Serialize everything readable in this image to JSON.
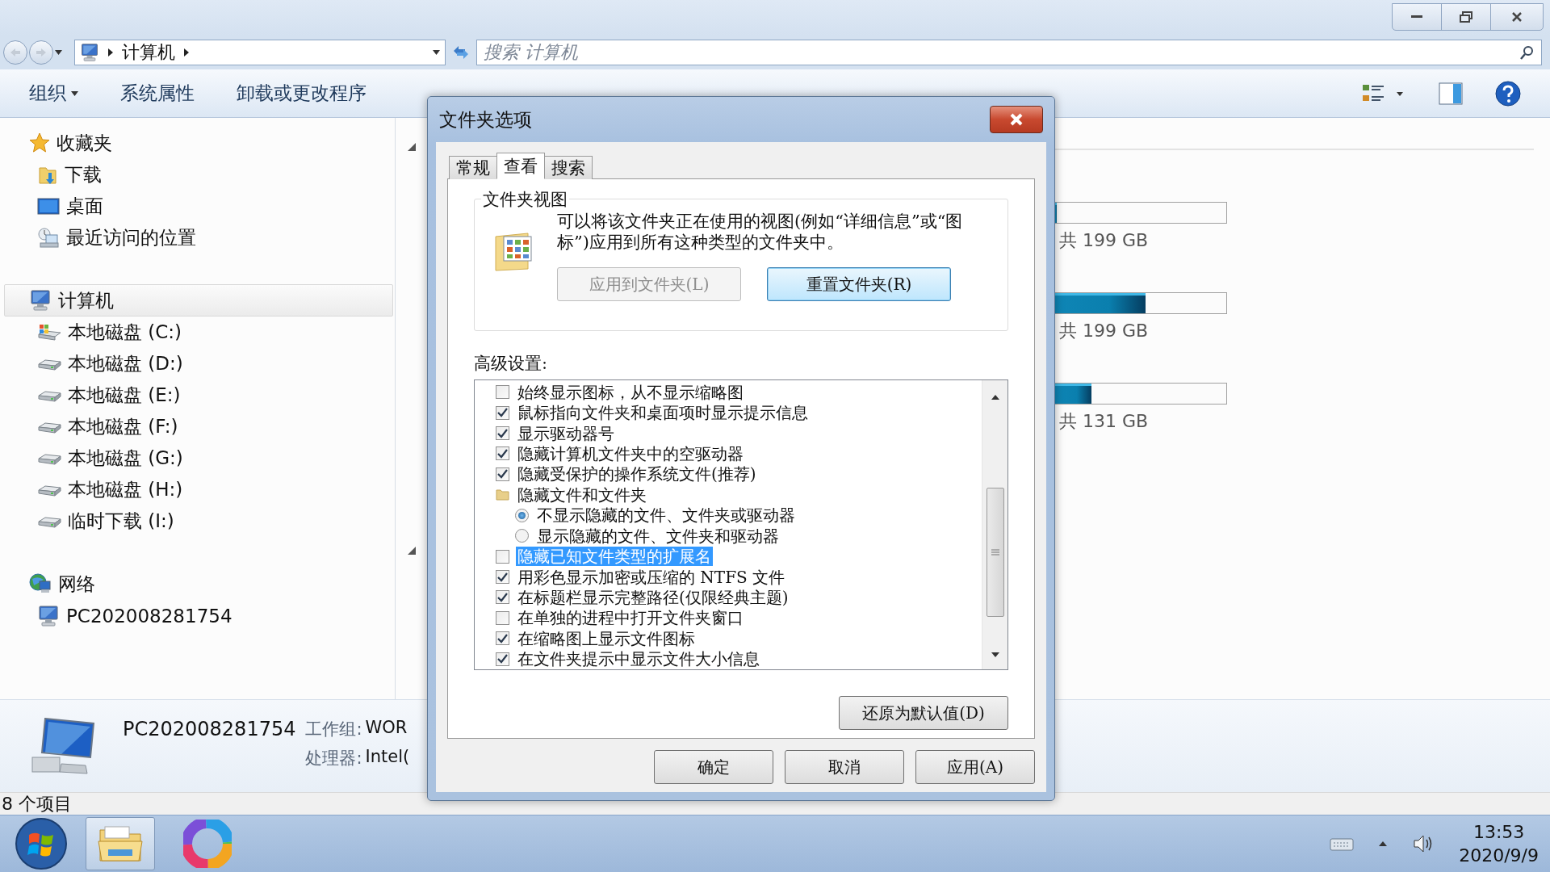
{
  "address_bar": {
    "path": [
      "计算机"
    ]
  },
  "search": {
    "placeholder": "搜索 计算机"
  },
  "toolbar": {
    "items": [
      {
        "label": "组织",
        "kind": "menu"
      },
      {
        "label": "系统属性",
        "kind": "plain"
      },
      {
        "label": "卸载或更改程序",
        "kind": "plain"
      }
    ]
  },
  "nav": {
    "sections": [
      {
        "label": "收藏夹",
        "kind": "favorites",
        "selected": false,
        "children": [
          {
            "label": "下载",
            "kind": "download",
            "selected": false
          },
          {
            "label": "桌面",
            "kind": "desktop",
            "selected": false
          },
          {
            "label": "最近访问的位置",
            "kind": "recent",
            "selected": false
          }
        ]
      },
      {
        "label": "计算机",
        "kind": "computer",
        "selected": true,
        "children": [
          {
            "label": "本地磁盘 (C:)",
            "kind": "system-drive",
            "selected": false
          },
          {
            "label": "本地磁盘 (D:)",
            "kind": "drive",
            "selected": false
          },
          {
            "label": "本地磁盘 (E:)",
            "kind": "drive",
            "selected": false
          },
          {
            "label": "本地磁盘 (F:)",
            "kind": "drive",
            "selected": false
          },
          {
            "label": "本地磁盘 (G:)",
            "kind": "drive",
            "selected": false
          },
          {
            "label": "本地磁盘 (H:)",
            "kind": "drive",
            "selected": false
          },
          {
            "label": "临时下载 (I:)",
            "kind": "drive",
            "selected": false
          }
        ]
      },
      {
        "label": "网络",
        "kind": "network",
        "selected": false,
        "children": [
          {
            "label": "PC202008281754",
            "kind": "pc",
            "selected": false
          }
        ]
      }
    ]
  },
  "drives": [
    {
      "level": 0,
      "size": "共 199 GB"
    },
    {
      "level": 0.53,
      "size": "共 199 GB"
    },
    {
      "level": 0.21,
      "size": "共 131 GB"
    }
  ],
  "details": {
    "name": "PC202008281754",
    "fields": [
      {
        "label": "工作组:",
        "value": "WOR"
      },
      {
        "label": "处理器:",
        "value": "Intel("
      }
    ]
  },
  "status_bar": "8 个项目",
  "dialog": {
    "title": "文件夹选项",
    "tabs": [
      {
        "label": "常规",
        "selected": false
      },
      {
        "label": "查看",
        "selected": true
      },
      {
        "label": "搜索",
        "selected": false
      }
    ],
    "folder_views": {
      "title": "文件夹视图",
      "description": "可以将该文件夹正在使用的视图(例如“详细信息”或“图标”)应用到所有这种类型的文件夹中。",
      "buttons": [
        {
          "label": "应用到文件夹(L)",
          "disabled": true,
          "focused": false
        },
        {
          "label": "重置文件夹(R)",
          "disabled": false,
          "focused": true
        }
      ]
    },
    "advanced_label": "高级设置:",
    "settings": [
      {
        "kind": "checkbox",
        "label": "始终显示图标，从不显示缩略图",
        "checked": false,
        "selected": false
      },
      {
        "kind": "checkbox",
        "label": "鼠标指向文件夹和桌面项时显示提示信息",
        "checked": true,
        "selected": false
      },
      {
        "kind": "checkbox",
        "label": "显示驱动器号",
        "checked": true,
        "selected": false
      },
      {
        "kind": "checkbox",
        "label": "隐藏计算机文件夹中的空驱动器",
        "checked": true,
        "selected": false
      },
      {
        "kind": "checkbox",
        "label": "隐藏受保护的操作系统文件(推荐)",
        "checked": true,
        "selected": false
      },
      {
        "kind": "folder",
        "label": "隐藏文件和文件夹",
        "selected": false
      },
      {
        "kind": "radio",
        "label": "不显示隐藏的文件、文件夹或驱动器",
        "checked": true,
        "selected": false
      },
      {
        "kind": "radio",
        "label": "显示隐藏的文件、文件夹和驱动器",
        "checked": false,
        "selected": false
      },
      {
        "kind": "checkbox",
        "label": "隐藏已知文件类型的扩展名",
        "checked": false,
        "selected": true
      },
      {
        "kind": "checkbox",
        "label": "用彩色显示加密或压缩的 NTFS 文件",
        "checked": true,
        "selected": false
      },
      {
        "kind": "checkbox",
        "label": "在标题栏显示完整路径(仅限经典主题)",
        "checked": true,
        "selected": false
      },
      {
        "kind": "checkbox",
        "label": "在单独的进程中打开文件夹窗口",
        "checked": false,
        "selected": false
      },
      {
        "kind": "checkbox",
        "label": "在缩略图上显示文件图标",
        "checked": true,
        "selected": false
      },
      {
        "kind": "checkbox",
        "label": "在文件夹提示中显示文件大小信息",
        "checked": true,
        "selected": false
      }
    ],
    "restore_button": "还原为默认值(D)",
    "buttons": [
      "确定",
      "取消",
      "应用(A)"
    ]
  },
  "taskbar": {
    "apps": [
      {
        "kind": "explorer",
        "selected": true
      },
      {
        "kind": "browser",
        "selected": false
      }
    ],
    "clock": {
      "time": "13:53",
      "date": "2020/9/9"
    }
  }
}
